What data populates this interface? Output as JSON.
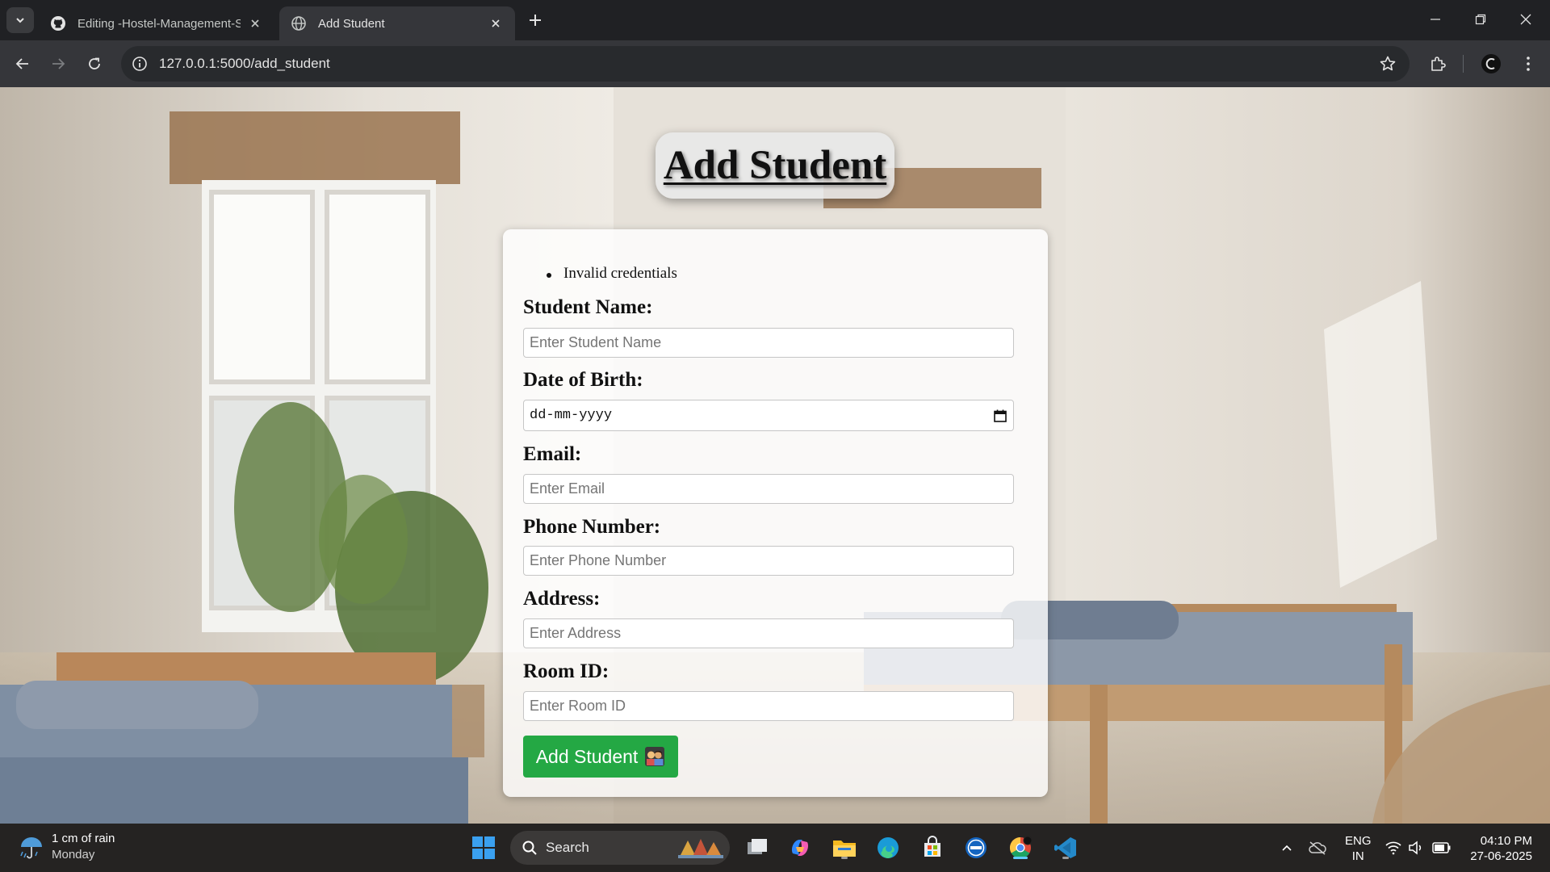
{
  "browser": {
    "tabs": [
      {
        "title": "Editing -Hostel-Management-S",
        "icon": "github-icon",
        "active": false
      },
      {
        "title": "Add Student",
        "icon": "globe-icon",
        "active": true
      }
    ],
    "url": "127.0.0.1:5000/add_student"
  },
  "page": {
    "heading": "Add Student",
    "flash_messages": [
      "Invalid credentials"
    ],
    "form": {
      "fields": [
        {
          "label": "Student Name:",
          "placeholder": "Enter Student Name",
          "type": "text"
        },
        {
          "label": "Date of Birth:",
          "placeholder": "dd-mm-yyyy",
          "type": "date"
        },
        {
          "label": "Email:",
          "placeholder": "Enter Email",
          "type": "email"
        },
        {
          "label": "Phone Number:",
          "placeholder": "Enter Phone Number",
          "type": "tel"
        },
        {
          "label": "Address:",
          "placeholder": "Enter Address",
          "type": "text"
        },
        {
          "label": "Room ID:",
          "placeholder": "Enter Room ID",
          "type": "text"
        }
      ],
      "submit_label": "Add Student",
      "submit_color": "#24a844"
    }
  },
  "taskbar": {
    "weather": {
      "line1": "1 cm of rain",
      "line2": "Monday"
    },
    "search_label": "Search",
    "apps": [
      "windows-start-icon",
      "search",
      "task-view-icon",
      "copilot-icon",
      "file-explorer-icon",
      "edge-icon",
      "microsoft-store-icon",
      "dell-icon",
      "chrome-icon",
      "vscode-icon"
    ],
    "lang": {
      "line1": "ENG",
      "line2": "IN"
    },
    "clock": {
      "time": "04:10 PM",
      "date": "27-06-2025"
    }
  }
}
